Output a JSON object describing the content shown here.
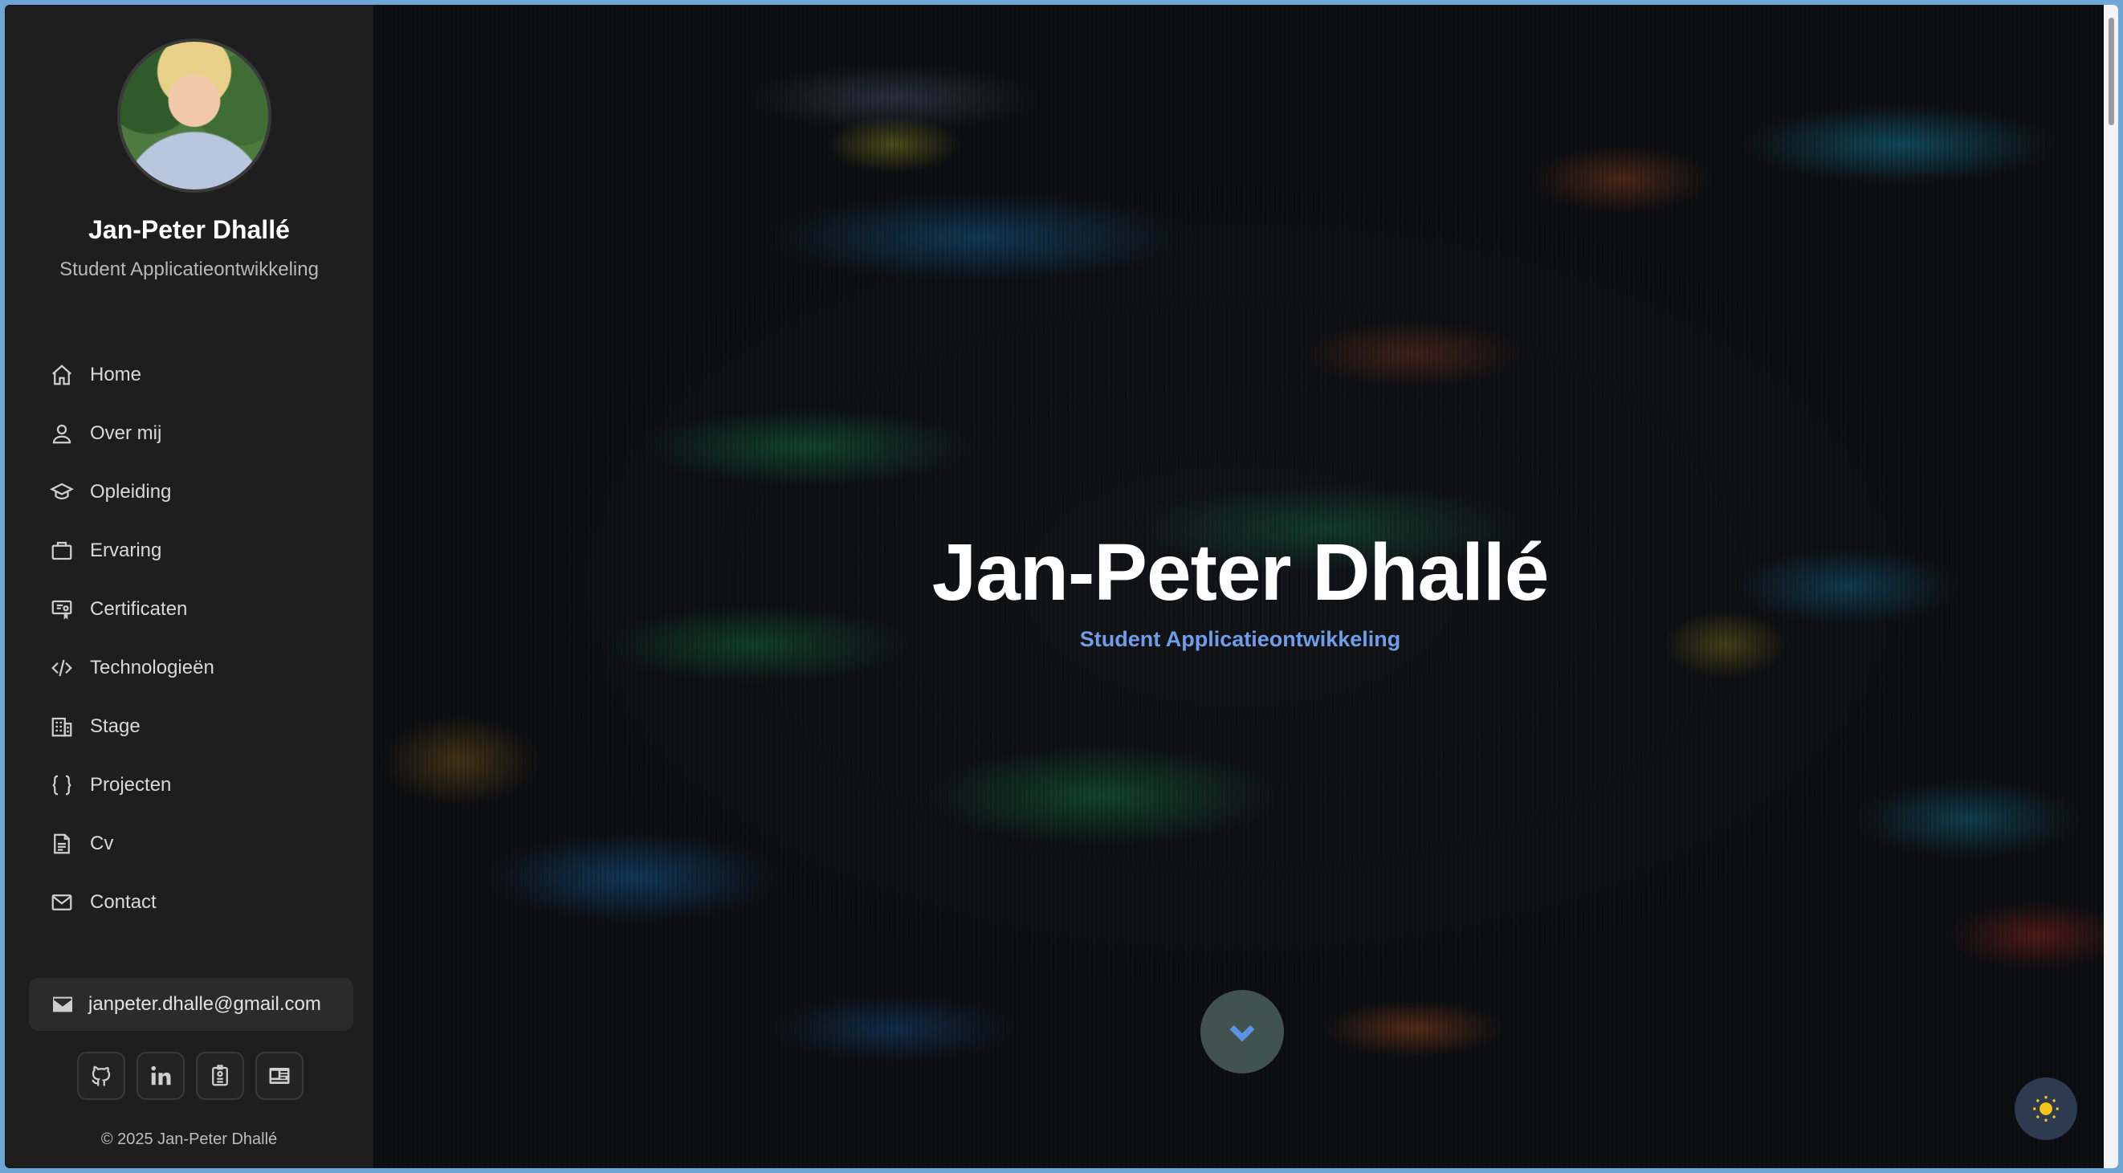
{
  "profile": {
    "name": "Jan-Peter Dhallé",
    "role": "Student Applicatieontwikkeling",
    "avatar_icon": "profile-photo"
  },
  "nav": {
    "items": [
      {
        "label": "Home",
        "icon": "home-icon"
      },
      {
        "label": "Over mij",
        "icon": "user-icon"
      },
      {
        "label": "Opleiding",
        "icon": "graduation-cap-icon"
      },
      {
        "label": "Ervaring",
        "icon": "briefcase-icon"
      },
      {
        "label": "Certificaten",
        "icon": "certificate-icon"
      },
      {
        "label": "Technologieën",
        "icon": "code-icon"
      },
      {
        "label": "Stage",
        "icon": "building-icon"
      },
      {
        "label": "Projecten",
        "icon": "braces-icon"
      },
      {
        "label": "Cv",
        "icon": "document-icon"
      },
      {
        "label": "Contact",
        "icon": "mail-icon"
      }
    ]
  },
  "contact": {
    "email": "janpeter.dhalle@gmail.com"
  },
  "socials": [
    {
      "name": "github-icon"
    },
    {
      "name": "linkedin-icon"
    },
    {
      "name": "badge-icon"
    },
    {
      "name": "id-card-icon"
    }
  ],
  "footer": {
    "copyright": "© 2025 Jan-Peter Dhallé"
  },
  "hero": {
    "title": "Jan-Peter Dhallé",
    "subtitle": "Student Applicatieontwikkeling"
  },
  "colors": {
    "sidebar_bg": "#1e1e1f",
    "accent": "#6f9ee8",
    "theme_toggle_bg": "#2d3a4f",
    "sun": "#f5c518"
  }
}
